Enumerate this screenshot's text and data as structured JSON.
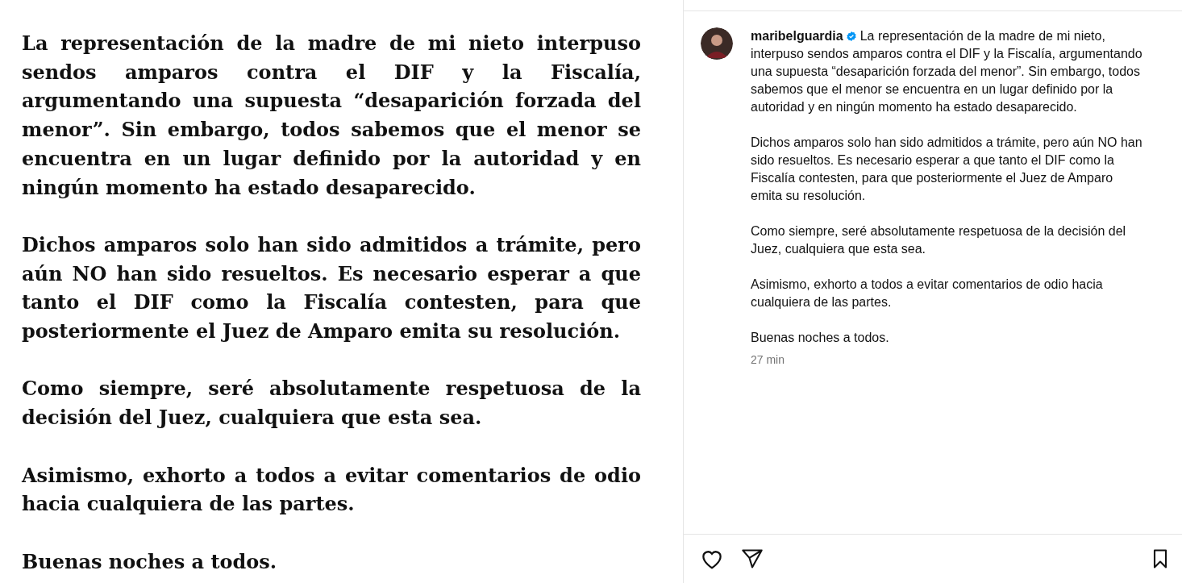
{
  "post_image": {
    "paragraphs": [
      "La representación de la madre de mi nieto interpuso sendos amparos contra el DIF y la Fiscalía, argumentando una supuesta “desaparición forzada del menor”. Sin embargo, todos sabemos que el menor se encuentra en un lugar definido por la autoridad y en ningún momento ha estado desaparecido.",
      "Dichos amparos solo han sido admitidos a trámite, pero aún NO han sido resueltos. Es necesario esperar a que tanto el DIF como la Fiscalía contesten, para que posteriormente el Juez de Amparo emita su resolución.",
      "Como siempre, seré absolutamente respetuosa de la decisión del Juez, cualquiera que esta sea.",
      "Asimismo, exhorto a todos a evitar comentarios de odio hacia cualquiera de las partes.",
      "Buenas noches a todos."
    ]
  },
  "caption": {
    "username": "maribelguardia",
    "verified": true,
    "paragraphs": [
      "La representación de la madre de mi nieto, interpuso sendos amparos contra el DIF y la Fiscalía, argumentando una supuesta “desaparición forzada del menor”. Sin embargo, todos sabemos que el menor se encuentra en un lugar definido por la autoridad y en ningún momento ha estado desaparecido.",
      "Dichos amparos solo han sido admitidos a trámite, pero aún NO han sido resueltos. Es necesario esperar a que tanto el DIF como la Fiscalía contesten, para que posteriormente el Juez de Amparo emita su resolución.",
      "Como siempre, seré absolutamente respetuosa de la decisión del Juez, cualquiera que esta sea.",
      "Asimismo, exhorto a todos a evitar comentarios de odio hacia cualquiera de las partes.",
      "Buenas noches a todos."
    ],
    "time": "27 min"
  },
  "actions": {
    "liked": false,
    "saved": false
  }
}
